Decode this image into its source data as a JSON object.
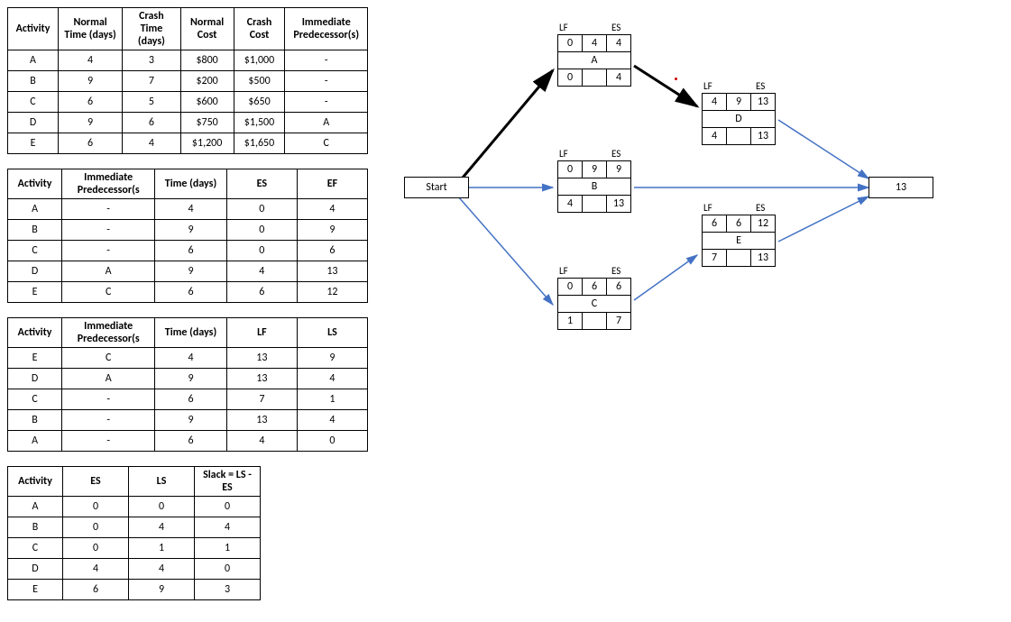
{
  "table1": {
    "headers": [
      "Activity",
      "Normal Time (days)",
      "Crash Time (days)",
      "Normal Cost",
      "Crash Cost",
      "Immediate Predecessor(s)"
    ],
    "rows": [
      [
        "A",
        "4",
        "3",
        "$800",
        "$1,000",
        "-"
      ],
      [
        "B",
        "9",
        "7",
        "$200",
        "$500",
        "-"
      ],
      [
        "C",
        "6",
        "5",
        "$600",
        "$650",
        "-"
      ],
      [
        "D",
        "9",
        "6",
        "$750",
        "$1,500",
        "A"
      ],
      [
        "E",
        "6",
        "4",
        "$1,200",
        "$1,650",
        "C"
      ]
    ]
  },
  "table2": {
    "headers": [
      "Activity",
      "Immediate Predecessor(s",
      "Time (days)",
      "ES",
      "EF"
    ],
    "rows": [
      [
        "A",
        "-",
        "4",
        "0",
        "4"
      ],
      [
        "B",
        "-",
        "9",
        "0",
        "9"
      ],
      [
        "C",
        "-",
        "6",
        "0",
        "6"
      ],
      [
        "D",
        "A",
        "9",
        "4",
        "13"
      ],
      [
        "E",
        "C",
        "6",
        "6",
        "12"
      ]
    ]
  },
  "table3": {
    "headers": [
      "Activity",
      "Immediate Predecessor(s",
      "Time (days)",
      "LF",
      "LS"
    ],
    "rows": [
      [
        "E",
        "C",
        "4",
        "13",
        "9"
      ],
      [
        "D",
        "A",
        "9",
        "13",
        "4"
      ],
      [
        "C",
        "-",
        "6",
        "7",
        "1"
      ],
      [
        "B",
        "-",
        "9",
        "13",
        "4"
      ],
      [
        "A",
        "-",
        "6",
        "4",
        "0"
      ]
    ]
  },
  "table4": {
    "headers": [
      "Activity",
      "ES",
      "LS",
      "Slack = LS - ES"
    ],
    "rows": [
      [
        "A",
        "0",
        "0",
        "0"
      ],
      [
        "B",
        "0",
        "4",
        "4"
      ],
      [
        "C",
        "0",
        "1",
        "1"
      ],
      [
        "D",
        "4",
        "4",
        "0"
      ],
      [
        "E",
        "6",
        "9",
        "3"
      ]
    ]
  },
  "diagram": {
    "start": "Start",
    "end": "13",
    "lf_label": "LF",
    "es_label": "ES",
    "nodes": {
      "A": {
        "top": [
          "0",
          "4",
          "4"
        ],
        "mid": "A",
        "bot": [
          "0",
          "",
          "4"
        ]
      },
      "B": {
        "top": [
          "0",
          "9",
          "9"
        ],
        "mid": "B",
        "bot": [
          "4",
          "",
          "13"
        ]
      },
      "C": {
        "top": [
          "0",
          "6",
          "6"
        ],
        "mid": "C",
        "bot": [
          "1",
          "",
          "7"
        ]
      },
      "D": {
        "top": [
          "4",
          "9",
          "13"
        ],
        "mid": "D",
        "bot": [
          "4",
          "",
          "13"
        ]
      },
      "E": {
        "top": [
          "6",
          "6",
          "12"
        ],
        "mid": "E",
        "bot": [
          "7",
          "",
          "13"
        ]
      }
    }
  },
  "chart_data": {
    "type": "table",
    "description": "Project crashing / CPM network with five activities A–E.",
    "activities": [
      {
        "id": "A",
        "normal_time": 4,
        "crash_time": 3,
        "normal_cost": 800,
        "crash_cost": 1000,
        "pred": [],
        "ES": 0,
        "EF": 4,
        "LS": 0,
        "LF": 4,
        "slack": 0
      },
      {
        "id": "B",
        "normal_time": 9,
        "crash_time": 7,
        "normal_cost": 200,
        "crash_cost": 500,
        "pred": [],
        "ES": 0,
        "EF": 9,
        "LS": 4,
        "LF": 13,
        "slack": 4
      },
      {
        "id": "C",
        "normal_time": 6,
        "crash_time": 5,
        "normal_cost": 600,
        "crash_cost": 650,
        "pred": [],
        "ES": 0,
        "EF": 6,
        "LS": 1,
        "LF": 7,
        "slack": 1
      },
      {
        "id": "D",
        "normal_time": 9,
        "crash_time": 6,
        "normal_cost": 750,
        "crash_cost": 1500,
        "pred": [
          "A"
        ],
        "ES": 4,
        "EF": 13,
        "LS": 4,
        "LF": 13,
        "slack": 0
      },
      {
        "id": "E",
        "normal_time": 6,
        "crash_time": 4,
        "normal_cost": 1200,
        "crash_cost": 1650,
        "pred": [
          "C"
        ],
        "ES": 6,
        "EF": 12,
        "LS": 9,
        "LF": 13,
        "slack": 3
      }
    ],
    "project_duration": 13,
    "network_edges": [
      [
        "Start",
        "A"
      ],
      [
        "Start",
        "B"
      ],
      [
        "Start",
        "C"
      ],
      [
        "A",
        "D"
      ],
      [
        "C",
        "E"
      ],
      [
        "D",
        "End"
      ],
      [
        "B",
        "End"
      ],
      [
        "E",
        "End"
      ]
    ]
  }
}
